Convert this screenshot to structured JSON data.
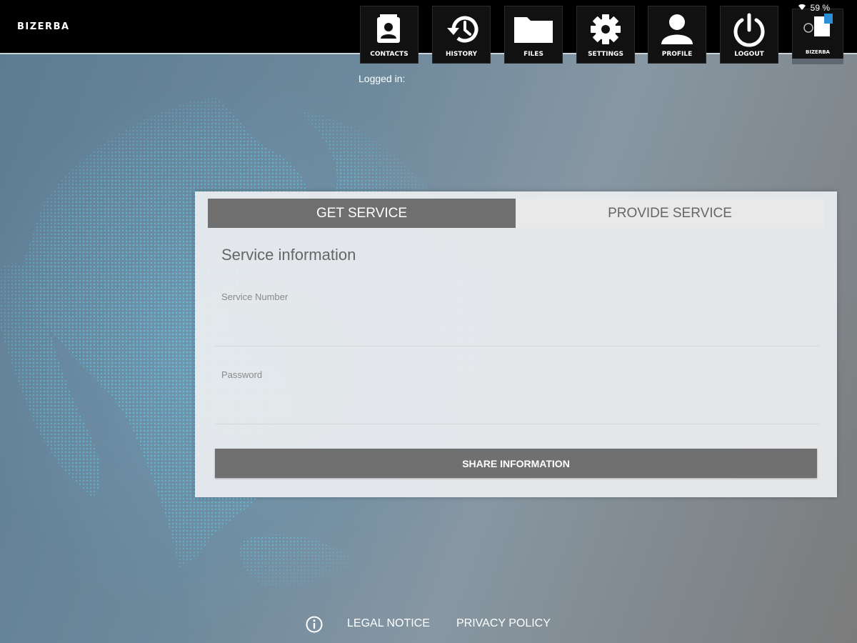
{
  "header": {
    "logo": "BIZERBA",
    "status": {
      "battery": "59 %"
    },
    "nav": [
      {
        "label": "CONTACTS",
        "icon": "contacts-icon"
      },
      {
        "label": "HISTORY",
        "icon": "history-icon"
      },
      {
        "label": "FILES",
        "icon": "folder-icon"
      },
      {
        "label": "SETTINGS",
        "icon": "gear-icon"
      },
      {
        "label": "PROFILE",
        "icon": "person-icon"
      },
      {
        "label": "LOGOUT",
        "icon": "power-icon"
      }
    ],
    "brand_tile": {
      "label": "BIZERBA",
      "icon": "bizerba-app-icon"
    }
  },
  "logged_in": "Logged in:",
  "card": {
    "tabs": [
      {
        "label": "GET SERVICE",
        "active": true
      },
      {
        "label": "PROVIDE SERVICE",
        "active": false
      }
    ],
    "section_title": "Service information",
    "fields": {
      "service_number_label": "Service Number",
      "service_number_value": "",
      "password_label": "Password",
      "password_value": ""
    },
    "share_button": "SHARE INFORMATION"
  },
  "footer": {
    "info_icon": "info-icon",
    "legal_notice": "LEGAL NOTICE",
    "privacy_policy": "PRIVACY POLICY"
  },
  "colors": {
    "topbar": "#000000",
    "tab_active": "#6f6f6f",
    "button": "#707070",
    "globe_dots": "#5fd2f0"
  }
}
